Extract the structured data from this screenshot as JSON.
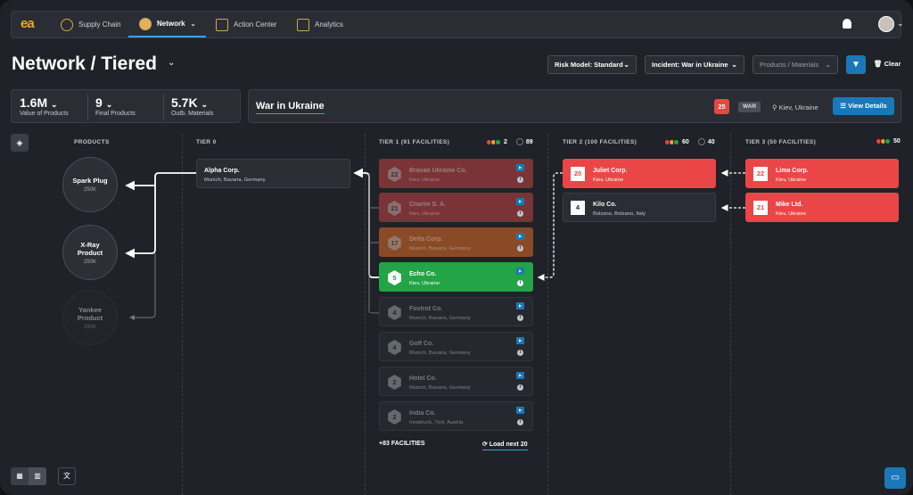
{
  "nav": {
    "logo": "ea",
    "items": [
      {
        "label": "Supply Chain",
        "active": false
      },
      {
        "label": "Network",
        "active": true
      },
      {
        "label": "Action Center",
        "active": false
      },
      {
        "label": "Analytics",
        "active": false
      }
    ]
  },
  "header": {
    "title": "Network / Tiered",
    "risk_model": "Risk Model: Standard",
    "incident": "Incident: War in Ukraine",
    "products_placeholder": "Products / Materials",
    "clear_label": "Clear"
  },
  "kpis": [
    {
      "value": "1.6M",
      "label": "Value of Products"
    },
    {
      "value": "9",
      "label": "Final Products"
    },
    {
      "value": "5.7K",
      "label": "Outb. Materials"
    }
  ],
  "incident_bar": {
    "title": "War in Ukraine",
    "count": "25",
    "tag": "WAR",
    "location": "Kiev, Ukraine",
    "button": "View Details"
  },
  "columns": {
    "products": "PRODUCTS",
    "tier0": "TIER 0",
    "tier1": "TIER 1 (91 FACILITIES)",
    "tier1_alerts": "2",
    "tier1_ok": "89",
    "tier2": "TIER 2 (100 FACILITIES)",
    "tier2_alerts": "60",
    "tier2_ok": "40",
    "tier3": "TIER 3 (50 FACILITIES)",
    "tier3_alerts": "50"
  },
  "products": [
    {
      "name": "Spark Plug",
      "value": "250K"
    },
    {
      "name": "X-Ray Product",
      "value": "250K"
    },
    {
      "name": "Yankee Product",
      "value": "250K"
    }
  ],
  "tier0": [
    {
      "name": "Alpha Corp.",
      "location": "Munich, Bavaria, Germany"
    }
  ],
  "tier1": [
    {
      "score": "22",
      "name": "Bravao Ukraine Co.",
      "location": "Kiev, Ukraine"
    },
    {
      "score": "21",
      "name": "Charlie S. A.",
      "location": "Kiev, Ukraine"
    },
    {
      "score": "17",
      "name": "Delta Corp.",
      "location": "Munich, Bavaria, Germany"
    },
    {
      "score": "5",
      "name": "Echo Co.",
      "location": "Kiev, Ukraine"
    },
    {
      "score": "4",
      "name": "Foxtrot Co.",
      "location": "Munich, Bavaria, Germany"
    },
    {
      "score": "4",
      "name": "Golf Co.",
      "location": "Munich, Bavaria, Germany"
    },
    {
      "score": "2",
      "name": "Hotel Co.",
      "location": "Munich, Bavaria, Germany"
    },
    {
      "score": "2",
      "name": "India Co.",
      "location": "Innsbruck, Tirol, Austria"
    }
  ],
  "tier1_more": "+83 FACILITIES",
  "load_next": "Load next 20",
  "tier2": [
    {
      "score": "20",
      "name": "Juliet Corp.",
      "location": "Kiev, Ukraine"
    },
    {
      "score": "4",
      "name": "Kilo Co.",
      "location": "Bolzano, Bolzano, Italy"
    }
  ],
  "tier3": [
    {
      "score": "22",
      "name": "Lima Corp.",
      "location": "Kiev, Ukraine"
    },
    {
      "score": "21",
      "name": "Mike Ltd.",
      "location": "Kiev, Ukraine"
    }
  ]
}
